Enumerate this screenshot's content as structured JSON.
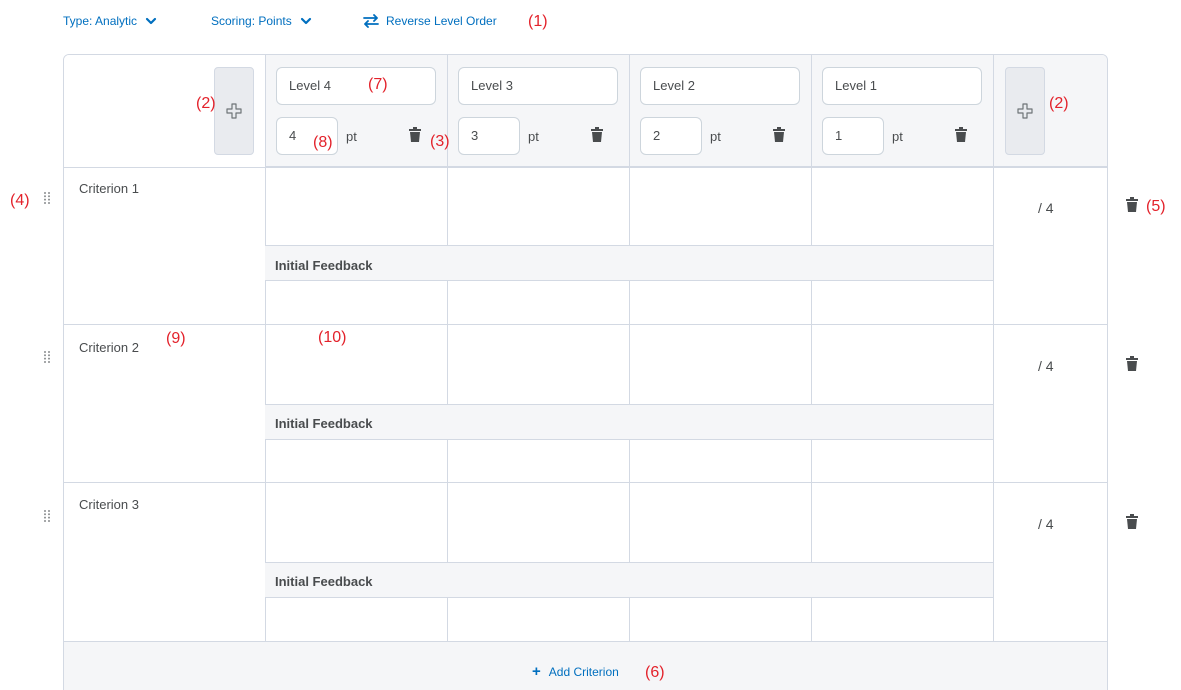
{
  "toolbar": {
    "type_label": "Type: Analytic",
    "scoring_label": "Scoring: Points",
    "reverse_label": "Reverse Level Order",
    "link_color": "#006fbf"
  },
  "levels": [
    {
      "name": "Level 4",
      "points": "4",
      "unit": "pt"
    },
    {
      "name": "Level 3",
      "points": "3",
      "unit": "pt"
    },
    {
      "name": "Level 2",
      "points": "2",
      "unit": "pt"
    },
    {
      "name": "Level 1",
      "points": "1",
      "unit": "pt"
    }
  ],
  "criteria": [
    {
      "name": "Criterion 1",
      "feedback_label": "Initial Feedback",
      "score": "/ 4"
    },
    {
      "name": "Criterion 2",
      "feedback_label": "Initial Feedback",
      "score": "/ 4"
    },
    {
      "name": "Criterion 3",
      "feedback_label": "Initial Feedback",
      "score": "/ 4"
    }
  ],
  "add_criterion_label": "Add Criterion",
  "annotations": {
    "a1": "(1)",
    "a2": "(2)",
    "a3": "(3)",
    "a4": "(4)",
    "a5": "(5)",
    "a6": "(6)",
    "a7": "(7)",
    "a8": "(8)",
    "a9": "(9)",
    "a10": "(10)"
  },
  "colors": {
    "annotation": "#e3222b",
    "header_band": "#f5f6f8",
    "border": "#d3d9e3"
  },
  "icons": {
    "add_level": "plus-outline-icon",
    "delete": "trash-icon",
    "drag": "drag-handle-icon",
    "chevron": "chevron-down-icon",
    "swap": "swap-arrows-icon"
  }
}
